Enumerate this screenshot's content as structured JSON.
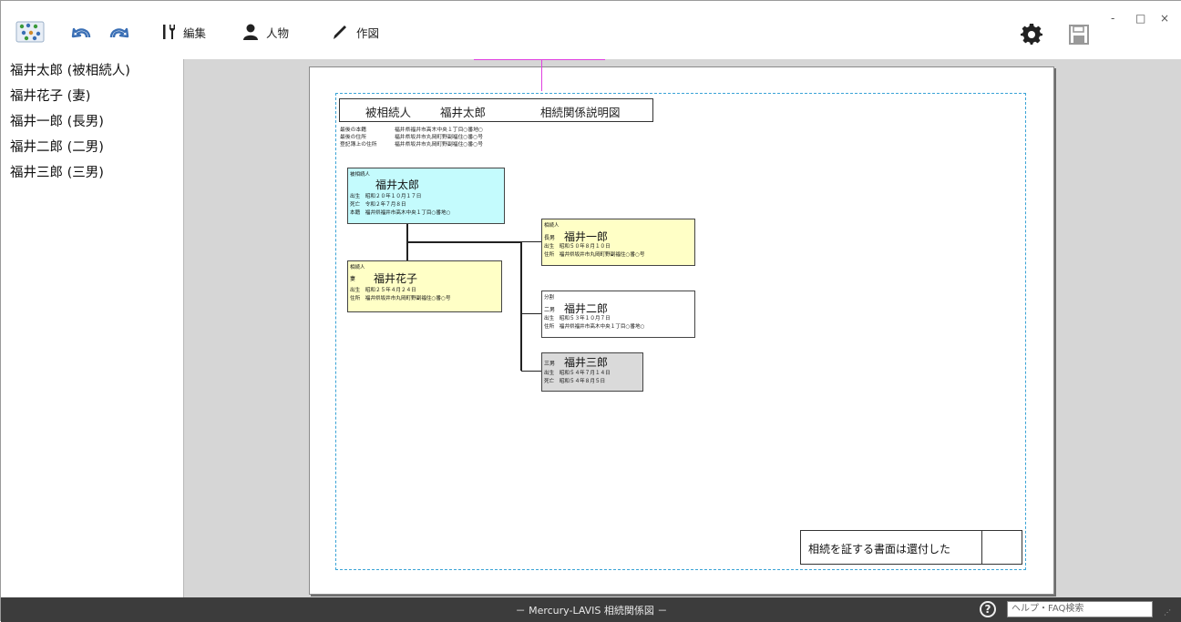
{
  "toolbar": {
    "edit_label": "編集",
    "person_label": "人物",
    "draw_label": "作図",
    "minimize": "-",
    "maximize": "□",
    "close": "×"
  },
  "sidebar": {
    "items": [
      {
        "label": "福井太郎 (被相続人)"
      },
      {
        "label": "福井花子 (妻)"
      },
      {
        "label": "福井一郎 (長男)"
      },
      {
        "label": "福井二郎 (二男)"
      },
      {
        "label": "福井三郎 (三男)"
      }
    ]
  },
  "document": {
    "title_role": "被相続人",
    "title_name": "福井太郎",
    "title_doc": "相続関係説明図",
    "addresses": [
      {
        "label": "最後の本籍",
        "value": "福井県福井市高木中央１丁目○番地○"
      },
      {
        "label": "最後の住所",
        "value": "福井県坂井市丸岡町野副福住○番○号"
      },
      {
        "label": "登記簿上の住所",
        "value": "福井県坂井市丸岡町野副福住○番○号"
      }
    ],
    "persons": {
      "taro": {
        "role": "被相続人",
        "name": "福井太郎",
        "lines": [
          "出生　昭和２０年１０月１７日",
          "死亡　令和２年７月８日",
          "本籍　福井県福井市高木中央１丁目○番地○"
        ]
      },
      "hanako": {
        "role": "相続人",
        "relation": "妻",
        "name": "福井花子",
        "lines": [
          "出生　昭和２５年４月２４日",
          "住所　福井県坂井市丸岡町野副福住○番○号"
        ]
      },
      "ichiro": {
        "role": "相続人",
        "relation": "長男",
        "name": "福井一郎",
        "lines": [
          "出生　昭和５０年８月１０日",
          "住所　福井県坂井市丸岡町野副福住○番○号"
        ]
      },
      "jiro": {
        "role": "分割",
        "relation": "二男",
        "name": "福井二郎",
        "lines": [
          "出生　昭和５３年１０月７日",
          "住所　福井県福井市高木中央１丁目○番地○"
        ]
      },
      "saburo": {
        "relation": "三男",
        "name": "福井三郎",
        "lines": [
          "出生　昭和５４年７月１４日",
          "死亡　昭和５４年８月５日"
        ]
      }
    },
    "stamp_text": "相続を証する書面は還付した"
  },
  "statusbar": {
    "title": "－ Mercury-LAVIS 相続関係図 －",
    "help_placeholder": "ヘルプ・FAQ検索"
  },
  "colors": {
    "deceased_fill": "#c4fbfd",
    "heir_fill": "#ffffc6",
    "division_fill": "#ffffff",
    "died_young_fill": "#dadada",
    "guide": "#e040e0",
    "margin": "#3aa3d6",
    "statusbar": "#3c3c3c",
    "icon_blue": "#3a6fb5"
  },
  "icons": [
    "app-logo-icon",
    "undo-icon",
    "redo-icon",
    "tools-icon",
    "person-icon",
    "pen-icon",
    "gear-icon",
    "save-icon",
    "help-icon"
  ]
}
